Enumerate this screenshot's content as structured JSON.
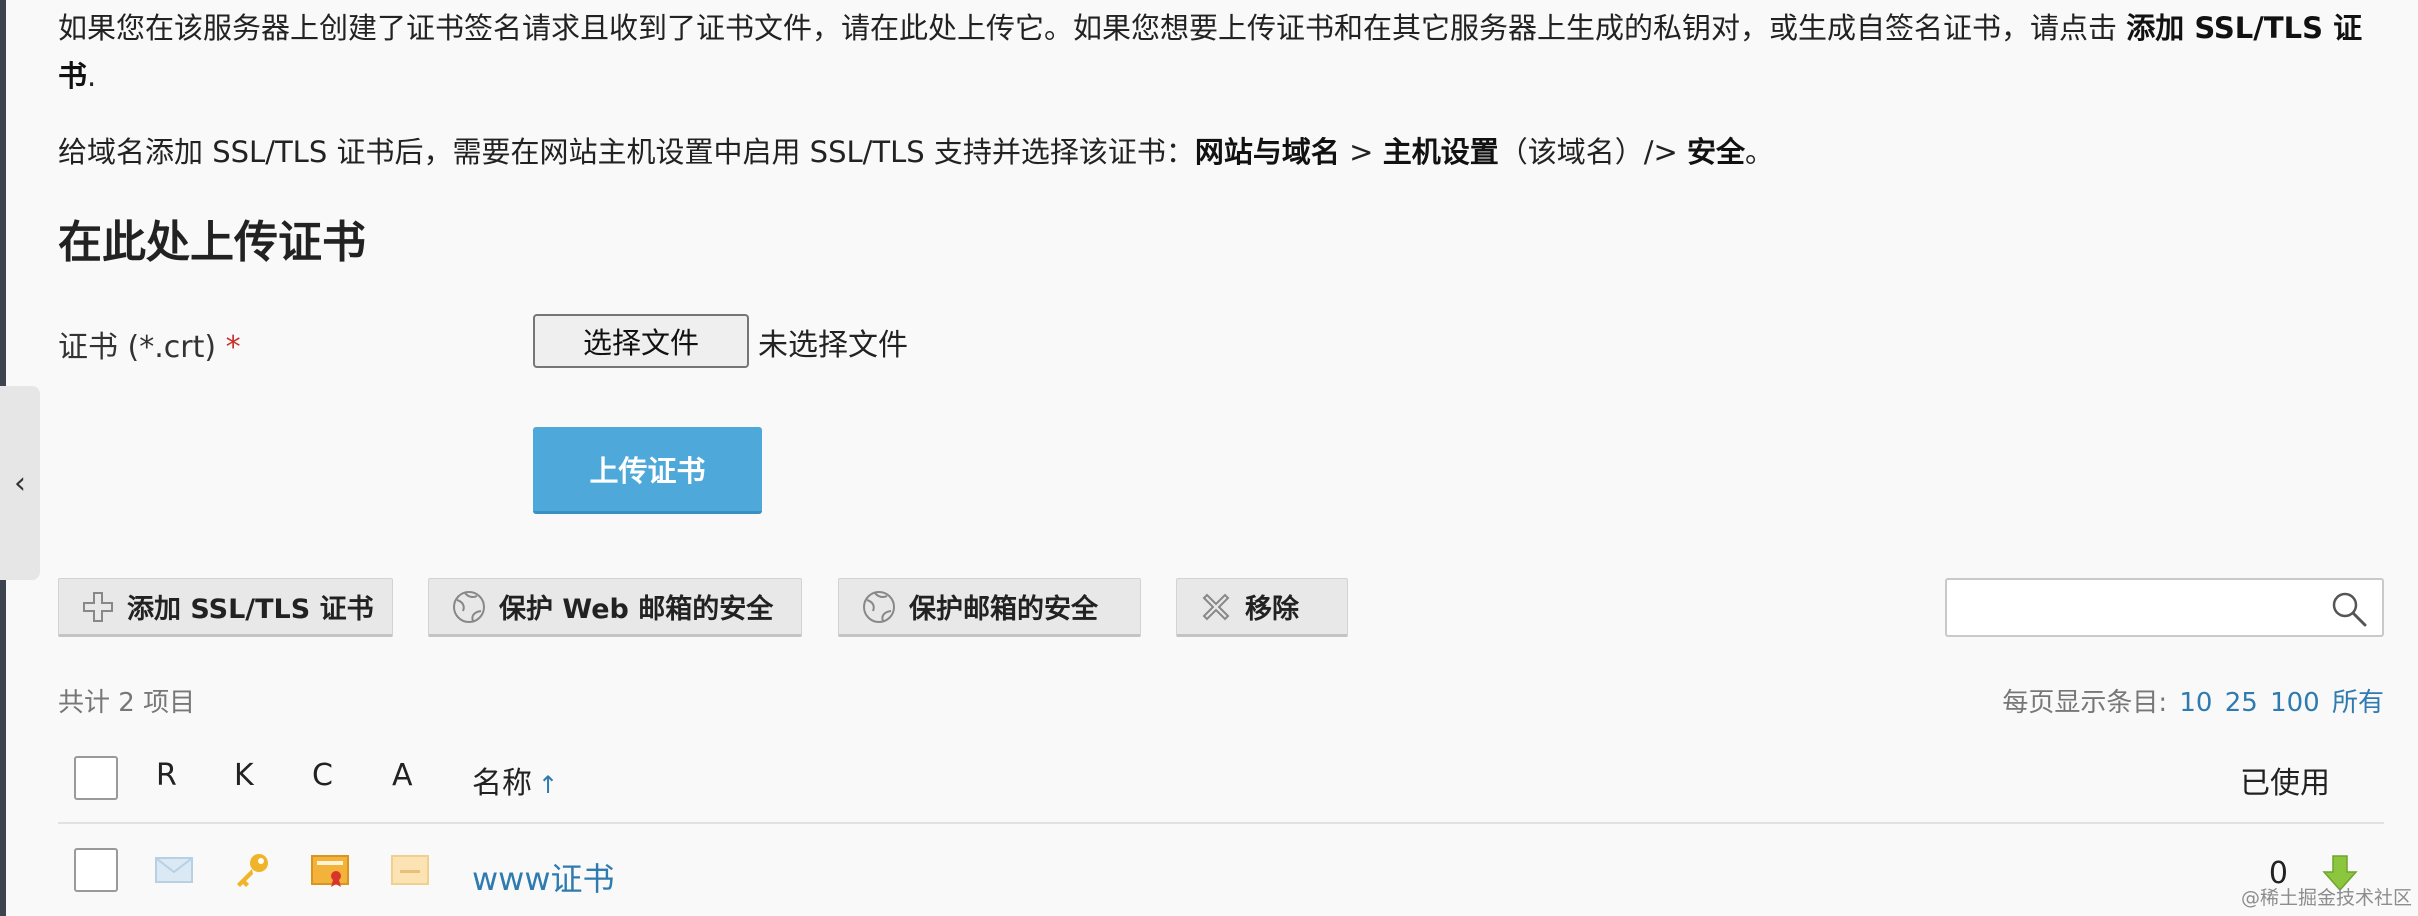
{
  "intro": {
    "p1_text": "如果您在该服务器上创建了证书签名请求且收到了证书文件，请在此处上传它。如果您想要上传证书和在其它服务器上生成的私钥对，或生成自签名证书，请点击 ",
    "p1_bold": "添加 SSL/TLS 证书",
    "p1_end": ".",
    "p2_text": "给域名添加 SSL/TLS 证书后，需要在网站主机设置中启用 SSL/TLS 支持并选择该证书：",
    "p2_b1": "网站与域名",
    "p2_sep1": " > ",
    "p2_b2": "主机设置",
    "p2_mid": "（该域名）/> ",
    "p2_b3": "安全",
    "p2_end": "。"
  },
  "upload": {
    "title": "在此处上传证书",
    "label": "证书 (*.crt)",
    "required_mark": "*",
    "choose_file": "选择文件",
    "no_file": "未选择文件",
    "submit": "上传证书"
  },
  "toolbar": {
    "add": "添加 SSL/TLS 证书",
    "secure_webmail": "保护 Web 邮箱的安全",
    "secure_mail": "保护邮箱的安全",
    "remove": "移除"
  },
  "search": {
    "placeholder": ""
  },
  "list": {
    "total": "共计 2 项目",
    "per_page_label": "每页显示条目:",
    "per_page_options": [
      "10",
      "25",
      "100",
      "所有"
    ]
  },
  "table": {
    "columns": [
      "R",
      "K",
      "C",
      "A",
      "名称",
      "已使用"
    ],
    "sort_arrow": "↑",
    "rows": [
      {
        "name": "www证书",
        "used": "0"
      }
    ]
  },
  "colors": {
    "accent": "#4ea8da",
    "link": "#2f7bb0",
    "required": "#c9302c"
  },
  "watermark": "@稀土掘金技术社区"
}
